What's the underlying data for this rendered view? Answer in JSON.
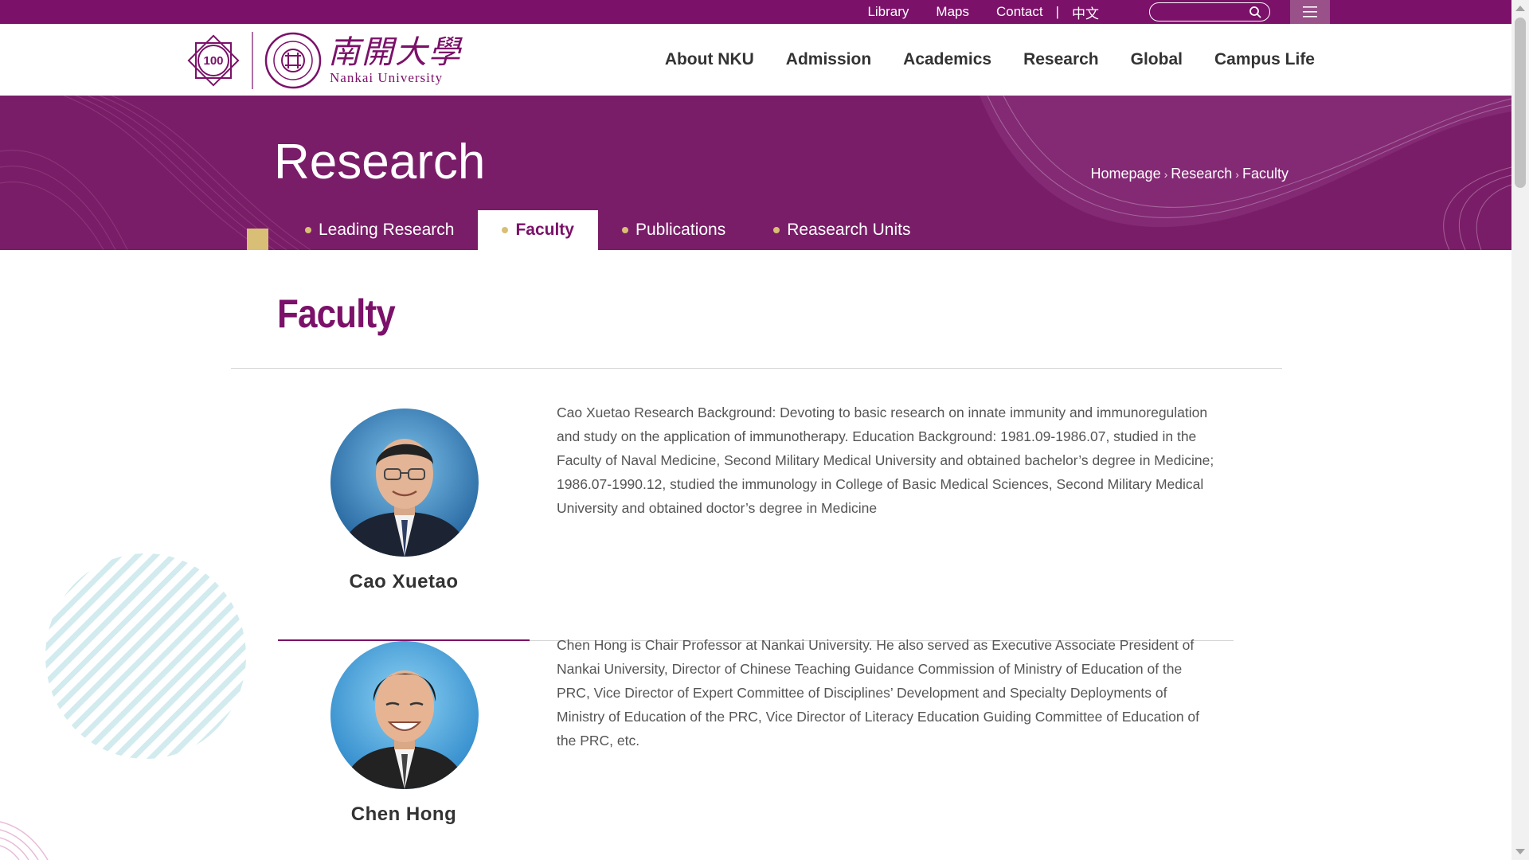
{
  "topbar": {
    "links": [
      "Library",
      "Maps",
      "Contact"
    ],
    "separator": "|",
    "lang": "中文",
    "search": {
      "placeholder": "",
      "value": ""
    }
  },
  "logo": {
    "badge_text": "100",
    "cn": "南開大學",
    "en": "Nankai University"
  },
  "nav": [
    "About NKU",
    "Admission",
    "Academics",
    "Research",
    "Global",
    "Campus Life"
  ],
  "banner": {
    "title": "Research",
    "breadcrumb": [
      "Homepage",
      "Research",
      "Faculty"
    ],
    "tabs": [
      {
        "label": "Leading Research",
        "active": false
      },
      {
        "label": "Faculty",
        "active": true
      },
      {
        "label": "Publications",
        "active": false
      },
      {
        "label": "Reasearch Units",
        "active": false
      }
    ]
  },
  "main": {
    "heading": "Faculty",
    "faculty": [
      {
        "name": "Cao Xuetao",
        "bio": "Cao Xuetao Research Background: Devoting to basic research on innate immunity and immunoregulation and study on the application of immunotherapy. Education Background: 1981.09-1986.07, studied in the Faculty of Naval Medicine, Second Military Medical University and obtained bachelor’s degree in Medicine; 1986.07-1990.12, studied the immunology in College of Basic Medical Sciences, Second Military Medical University and obtained doctor’s degree in Medicine"
      },
      {
        "name": "Chen Hong",
        "bio": "Chen Hong is Chair Professor at Nankai University. He also served as Executive Associate President of Nankai University, Director of Chinese Teaching Guidance Commission of Ministry of Education of the PRC, Vice Director of Expert Committee of Disciplines’ Development and Specialty Deployments of Ministry of Education of the PRC, Vice Director of Literacy Education Guiding Committee of Education of the PRC, etc."
      }
    ]
  },
  "colors": {
    "brand": "#7b1169",
    "banner": "#7a1d68",
    "gold": "#d9bf75",
    "deco": "#cde9ec"
  }
}
